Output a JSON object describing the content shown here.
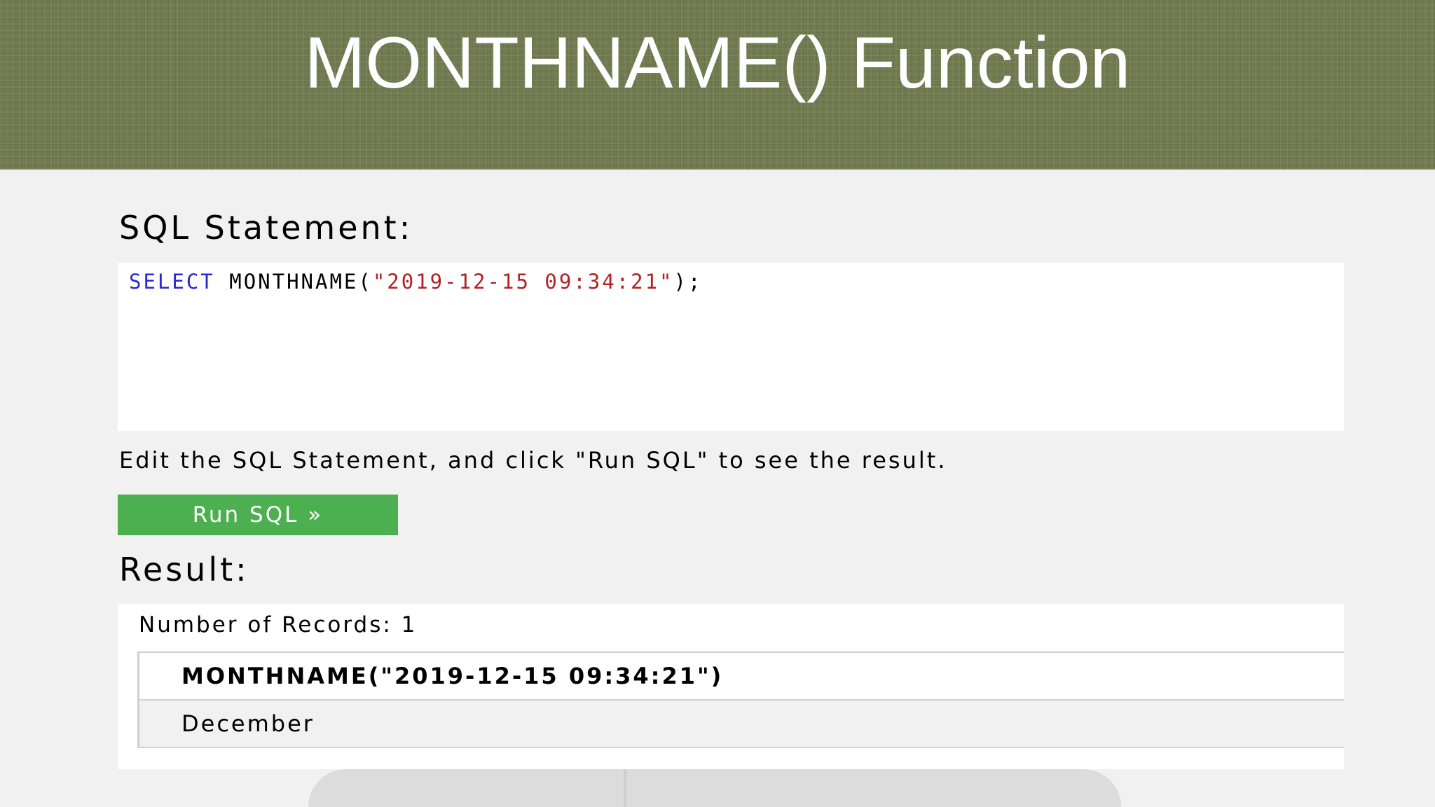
{
  "slide": {
    "title": "MONTHNAME() Function"
  },
  "sql_section": {
    "heading": "SQL Statement:",
    "code_keyword": "SELECT",
    "code_function": "MONTHNAME(",
    "code_string": "\"2019-12-15 09:34:21\"",
    "code_end": ");",
    "instruction": "Edit the SQL Statement, and click \"Run SQL\" to see the result.",
    "run_button_label": "Run SQL »"
  },
  "result_section": {
    "heading": "Result:",
    "records_text": "Number of Records: 1",
    "columns": [
      "MONTHNAME(\"2019-12-15 09:34:21\")"
    ],
    "rows": [
      [
        "December"
      ]
    ]
  },
  "colors": {
    "banner": "#727a50",
    "button": "#4caf50",
    "keyword": "#2a2ad0",
    "string": "#b22222"
  }
}
